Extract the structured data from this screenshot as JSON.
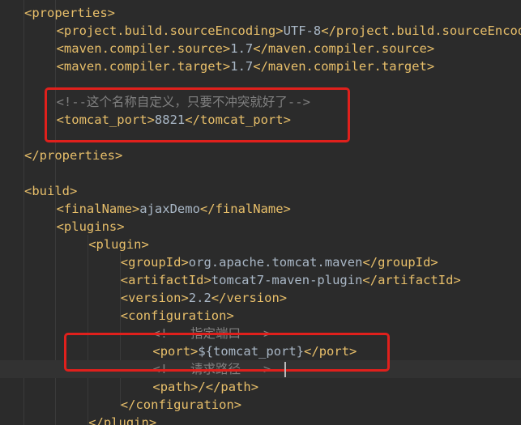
{
  "editor": {
    "language": "xml",
    "lines": [
      {
        "indent": 0,
        "parts": [
          {
            "k": "tag",
            "t": "<properties>"
          }
        ]
      },
      {
        "indent": 1,
        "parts": [
          {
            "k": "tag",
            "t": "<project.build.sourceEncoding>"
          },
          {
            "k": "txt",
            "t": "UTF-8"
          },
          {
            "k": "tag",
            "t": "</project.build.sourceEncoding>"
          }
        ]
      },
      {
        "indent": 1,
        "parts": [
          {
            "k": "tag",
            "t": "<maven.compiler.source>"
          },
          {
            "k": "txt",
            "t": "1.7"
          },
          {
            "k": "tag",
            "t": "</maven.compiler.source>"
          }
        ]
      },
      {
        "indent": 1,
        "parts": [
          {
            "k": "tag",
            "t": "<maven.compiler.target>"
          },
          {
            "k": "txt",
            "t": "1.7"
          },
          {
            "k": "tag",
            "t": "</maven.compiler.target>"
          }
        ]
      },
      {
        "indent": 0,
        "parts": []
      },
      {
        "indent": 1,
        "parts": [
          {
            "k": "cmt",
            "t": "<!--这个名称自定义，只要不冲突就好了-->"
          }
        ]
      },
      {
        "indent": 1,
        "parts": [
          {
            "k": "tag",
            "t": "<tomcat_port>"
          },
          {
            "k": "txt",
            "t": "8821"
          },
          {
            "k": "tag",
            "t": "</tomcat_port>"
          }
        ]
      },
      {
        "indent": 0,
        "parts": []
      },
      {
        "indent": 0,
        "parts": [
          {
            "k": "tag",
            "t": "</properties>"
          }
        ]
      },
      {
        "indent": 0,
        "parts": []
      },
      {
        "indent": 0,
        "parts": [
          {
            "k": "tag",
            "t": "<build>"
          }
        ]
      },
      {
        "indent": 1,
        "parts": [
          {
            "k": "tag",
            "t": "<finalName>"
          },
          {
            "k": "txt",
            "t": "ajaxDemo"
          },
          {
            "k": "tag",
            "t": "</finalName>"
          }
        ]
      },
      {
        "indent": 1,
        "parts": [
          {
            "k": "tag",
            "t": "<plugins>"
          }
        ]
      },
      {
        "indent": 2,
        "parts": [
          {
            "k": "tag",
            "t": "<plugin>"
          }
        ]
      },
      {
        "indent": 3,
        "parts": [
          {
            "k": "tag",
            "t": "<groupId>"
          },
          {
            "k": "txt",
            "t": "org.apache.tomcat.maven"
          },
          {
            "k": "tag",
            "t": "</groupId>"
          }
        ]
      },
      {
        "indent": 3,
        "parts": [
          {
            "k": "tag",
            "t": "<artifactId>"
          },
          {
            "k": "txt",
            "t": "tomcat7-maven-plugin"
          },
          {
            "k": "tag",
            "t": "</artifactId>"
          }
        ]
      },
      {
        "indent": 3,
        "parts": [
          {
            "k": "tag",
            "t": "<version>"
          },
          {
            "k": "txt",
            "t": "2.2"
          },
          {
            "k": "tag",
            "t": "</version>"
          }
        ]
      },
      {
        "indent": 3,
        "parts": [
          {
            "k": "tag",
            "t": "<configuration>"
          }
        ]
      },
      {
        "indent": 4,
        "parts": [
          {
            "k": "cmt",
            "t": "<!-- 指定端口 -->"
          }
        ]
      },
      {
        "indent": 4,
        "parts": [
          {
            "k": "tag",
            "t": "<port>"
          },
          {
            "k": "txt",
            "t": "${tomcat_port}"
          },
          {
            "k": "tag",
            "t": "</port>"
          }
        ]
      },
      {
        "indent": 4,
        "current": true,
        "parts": [
          {
            "k": "cmt",
            "t": "<!-- 请求路径 -->"
          }
        ]
      },
      {
        "indent": 4,
        "parts": [
          {
            "k": "tag",
            "t": "<path>"
          },
          {
            "k": "tag",
            "t": "/"
          },
          {
            "k": "tag",
            "t": "</path>"
          }
        ]
      },
      {
        "indent": 3,
        "parts": [
          {
            "k": "tag",
            "t": "</configuration>"
          }
        ]
      },
      {
        "indent": 2,
        "parts": [
          {
            "k": "tag",
            "t": "</plugin>"
          }
        ]
      }
    ]
  },
  "colors": {
    "background": "#2b2b2b",
    "tag": "#e8bf6a",
    "text": "#a9b7c6",
    "comment": "#808080",
    "highlight_box": "#e0201c"
  }
}
